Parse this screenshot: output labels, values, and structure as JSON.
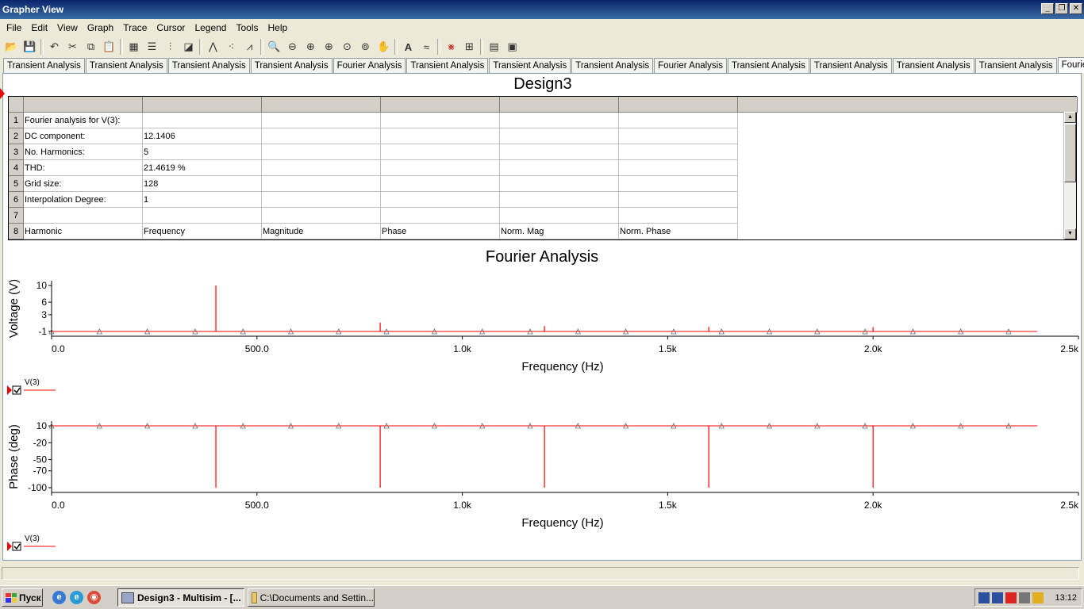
{
  "window": {
    "title": "Grapher View",
    "btn_min": "_",
    "btn_restore": "❐",
    "btn_close": "✕"
  },
  "menu": [
    "File",
    "Edit",
    "View",
    "Graph",
    "Trace",
    "Cursor",
    "Legend",
    "Tools",
    "Help"
  ],
  "tabs": [
    "Transient Analysis",
    "Transient Analysis",
    "Transient Analysis",
    "Transient Analysis",
    "Fourier Analysis",
    "Transient Analysis",
    "Transient Analysis",
    "Transient Analysis",
    "Fourier Analysis",
    "Transient Analysis",
    "Transient Analysis",
    "Transient Analysis",
    "Transient Analysis",
    "Fourier Analysis"
  ],
  "active_tab": 13,
  "sheet": {
    "title": "Design3",
    "rows": [
      [
        "1",
        "Fourier analysis for V(3):",
        "",
        "",
        "",
        "",
        ""
      ],
      [
        "2",
        "DC component:",
        "12.1406",
        "",
        "",
        "",
        ""
      ],
      [
        "3",
        "No. Harmonics:",
        "5",
        "",
        "",
        "",
        ""
      ],
      [
        "4",
        "THD:",
        "21.4619 %",
        "",
        "",
        "",
        ""
      ],
      [
        "5",
        "Grid size:",
        "128",
        "",
        "",
        "",
        ""
      ],
      [
        "6",
        "Interpolation Degree:",
        "1",
        "",
        "",
        "",
        ""
      ],
      [
        "7",
        "",
        "",
        "",
        "",
        "",
        ""
      ],
      [
        "8",
        "Harmonic",
        "Frequency",
        "Magnitude",
        "Phase",
        "Norm. Mag",
        "Norm. Phase"
      ]
    ]
  },
  "charts": {
    "title": "Fourier Analysis",
    "trace_color": "#ff0000",
    "x_ticks": [
      "0.0",
      "500.0",
      "1.0k",
      "1.5k",
      "2.0k",
      "2.5k"
    ],
    "magnitude": {
      "xlabel": "Frequency (Hz)",
      "ylabel": "Voltage (V)",
      "y_ticks": [
        "10",
        "6",
        "3",
        "-1"
      ],
      "legend": "V(3)"
    },
    "phase": {
      "xlabel": "Frequency (Hz)",
      "ylabel": "Phase (deg)",
      "y_ticks": [
        "10",
        "-20",
        "-50",
        "-70",
        "-100"
      ],
      "legend": "V(3)"
    }
  },
  "chart_data": [
    {
      "type": "bar",
      "title": "Fourier Analysis",
      "xlabel": "Frequency (Hz)",
      "ylabel": "Voltage (V)",
      "xlim": [
        0,
        2500
      ],
      "ylim": [
        -1,
        10
      ],
      "baseline": -1,
      "series": [
        {
          "name": "V(3)",
          "x": [
            400,
            800,
            1200,
            1600,
            2000
          ],
          "values": [
            10,
            1.1,
            0.3,
            0.1,
            0.05
          ]
        }
      ]
    },
    {
      "type": "bar",
      "title": "Fourier Analysis",
      "xlabel": "Frequency (Hz)",
      "ylabel": "Phase (deg)",
      "xlim": [
        0,
        2500
      ],
      "ylim": [
        -100,
        10
      ],
      "baseline": 10,
      "series": [
        {
          "name": "V(3)",
          "x": [
            400,
            800,
            1200,
            1600,
            2000
          ],
          "values": [
            -100,
            -100,
            -100,
            -100,
            -100
          ]
        }
      ]
    }
  ],
  "taskbar": {
    "start": "Пуск",
    "tasks": [
      "Design3 - Multisim - [...",
      "C:\\Documents and Settin..."
    ],
    "clock": "13:12"
  }
}
